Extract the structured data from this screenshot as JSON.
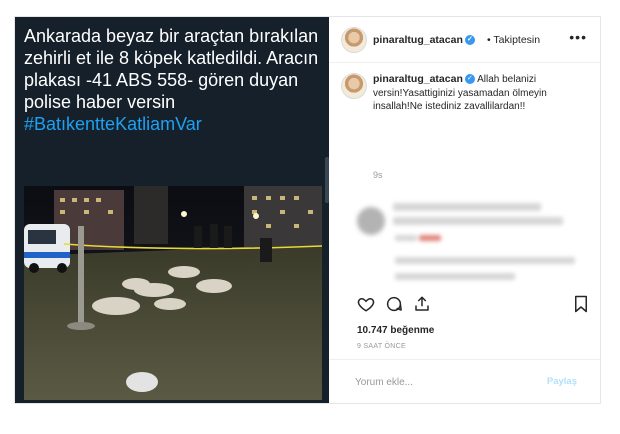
{
  "post_media": {
    "tweet_text": "Ankarada beyaz bir araçtan bırakılan zehirli et ile 8 köpek katledildi. Aracın plakası  -41 ABS 558- gören duyan polise haber versin",
    "hashtag": "#BatıkentteKatliamVar"
  },
  "header": {
    "username": "pinaraltug_atacan",
    "verified_glyph": "✓",
    "follow_status": "• Takiptesin",
    "more_icon": "•••"
  },
  "caption": {
    "username": "pinaraltug_atacan",
    "text": "Allah belanizi versin!Yasattiginizi yasamadan ölmeyin insallah!Ne istediniz zavallilardan!!",
    "time": "9s"
  },
  "actions": {
    "icons": [
      "heart-icon",
      "comment-icon",
      "share-icon",
      "bookmark-icon"
    ]
  },
  "likes": "10.747 beğenme",
  "posted_ago": "9 SAAT ÖNCE",
  "comment": {
    "placeholder": "Yorum ekle...",
    "post_label": "Paylaş"
  },
  "colors": {
    "media_bg": "#15202b",
    "hashtag": "#1da1f2",
    "verified": "#3897f0",
    "post_disabled": "#b2dffc"
  }
}
